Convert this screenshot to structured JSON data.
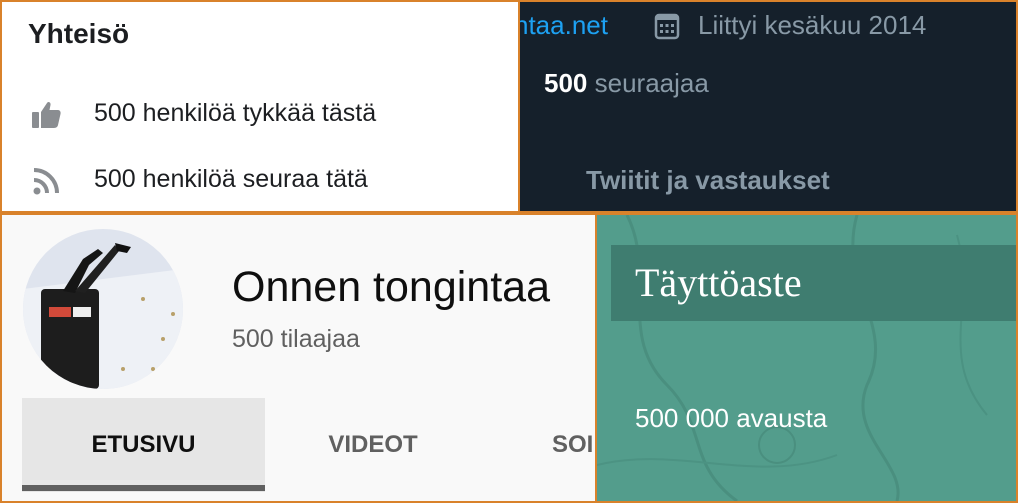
{
  "facebook": {
    "title": "Yhteisö",
    "rows": [
      {
        "icon": "thumbs-up-icon",
        "text": "500 henkilöä tykkää tästä"
      },
      {
        "icon": "rss-feed-icon",
        "text": "500 henkilöä seuraa tätä"
      }
    ]
  },
  "twitter": {
    "link": "ntaa.net",
    "joined": "Liittyi kesäkuu 2014",
    "followers_count": "500",
    "followers_label": "seuraajaa",
    "tab": "Twiitit ja vastaukset",
    "colors": {
      "background": "#15202b",
      "link": "#1da1f2",
      "muted": "#8899a6"
    }
  },
  "youtube": {
    "channel_name": "Onnen tongintaa",
    "subscribers": "500 tilaajaa",
    "tabs": [
      "ETUSIVU",
      "VIDEOT",
      "SOI"
    ],
    "active_tab": "ETUSIVU"
  },
  "mailing": {
    "heading": "Täyttöaste",
    "opens": "500 000 avausta",
    "colors": {
      "background": "#539d8c",
      "header": "#3f7d70"
    }
  },
  "colors": {
    "frame": "#d9822b"
  }
}
